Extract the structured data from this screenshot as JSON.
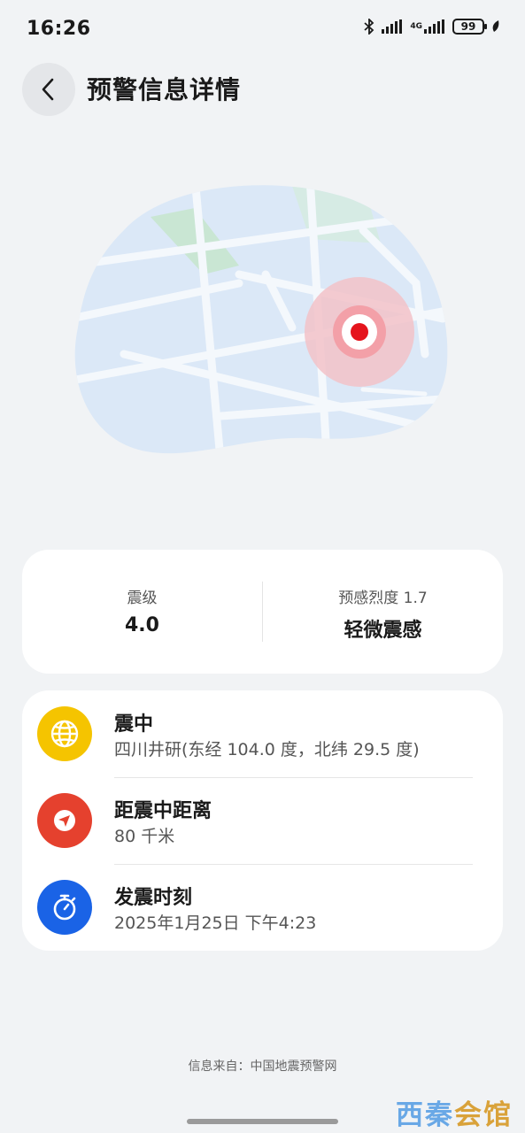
{
  "status_bar": {
    "time": "16:26",
    "network": "4G",
    "battery": "99"
  },
  "header": {
    "title": "预警信息详情"
  },
  "magnitude_card": {
    "magnitude_label": "震级",
    "magnitude_value": "4.0",
    "intensity_label": "预感烈度 1.7",
    "intensity_value": "轻微震感"
  },
  "info": {
    "epicenter_title": "震中",
    "epicenter_value": "四川井研(东经 104.0 度，北纬 29.5 度)",
    "distance_title": "距震中距离",
    "distance_value": "80 千米",
    "time_title": "发震时刻",
    "time_value": "2025年1月25日 下午4:23"
  },
  "footer": {
    "source": "信息来自：中国地震预警网"
  },
  "watermark": {
    "part1": "西秦",
    "part2": "会馆"
  },
  "colors": {
    "epicenter_icon": "#f5c400",
    "distance_icon": "#e5412e",
    "time_icon": "#1a63e6",
    "marker": "#e5141c"
  }
}
